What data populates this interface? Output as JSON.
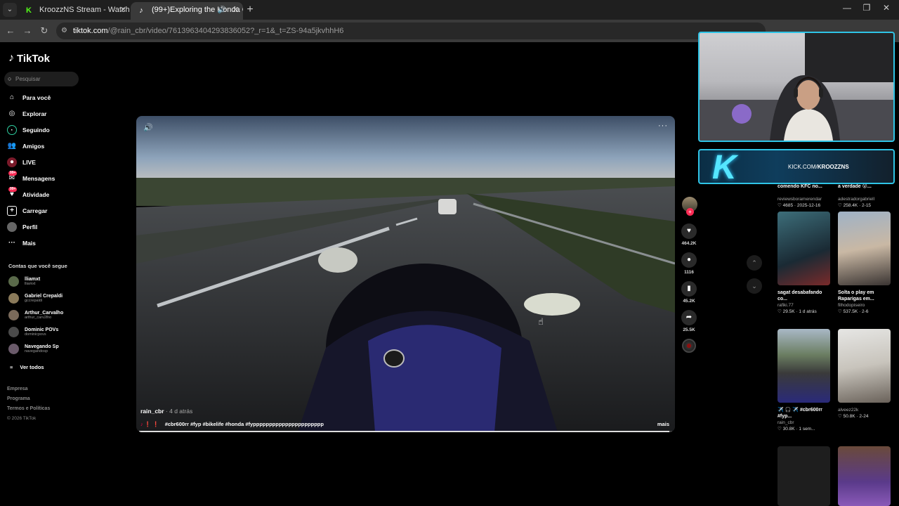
{
  "browser": {
    "tabs": [
      {
        "title": "KroozzNS Stream - Watch Live",
        "favicon": "K",
        "active": false
      },
      {
        "title": "(99+)Exploring the Honda C",
        "favicon": "♪",
        "active": true
      }
    ],
    "url_host": "tiktok.com",
    "url_path": "/@rain_cbr/video/7613963404293836052?_r=1&_t=ZS-94a5jkvhhH6"
  },
  "sidebar": {
    "brand": "TikTok",
    "search_placeholder": "Pesquisar",
    "nav": [
      {
        "label": "Para você",
        "icon": "home-icon"
      },
      {
        "label": "Explorar",
        "icon": "compass-icon"
      },
      {
        "label": "Seguindo",
        "icon": "following-icon"
      },
      {
        "label": "Amigos",
        "icon": "friends-icon"
      },
      {
        "label": "LIVE",
        "icon": "live-icon"
      },
      {
        "label": "Mensagens",
        "icon": "messages-icon",
        "badge": "99+"
      },
      {
        "label": "Atividade",
        "icon": "activity-icon",
        "badge": "99+"
      },
      {
        "label": "Carregar",
        "icon": "upload-icon"
      },
      {
        "label": "Perfil",
        "icon": "profile-icon"
      },
      {
        "label": "Mais",
        "icon": "more-icon"
      }
    ],
    "following_title": "Contas que você segue",
    "following": [
      {
        "name": "lliamxt",
        "handle": "lliamxt"
      },
      {
        "name": "Gabriel Crepaldi",
        "handle": "gccrepaldi"
      },
      {
        "name": "Arthur_Carvalho",
        "handle": "arthur_carv2lho"
      },
      {
        "name": "Dominic POVs",
        "handle": "dominicpovs"
      },
      {
        "name": "Navegando Sp",
        "handle": "navegandosp"
      }
    ],
    "see_all": "Ver todos",
    "footer": [
      "Empresa",
      "Programa",
      "Termos e Políticas"
    ],
    "copyright": "© 2026 TikTok"
  },
  "video": {
    "author": "rain_cbr",
    "posted": "· 4 d atrás",
    "caption_emojis": "♪ ❗ ❗",
    "caption": "#cbr600rr #fyp #bikelife #honda #fypppppppppppppppppppppp",
    "more_label": "mais",
    "progress": 0.995
  },
  "actions": {
    "likes": "464.2K",
    "comments": "1116",
    "saves": "45.2K",
    "shares": "25.5K"
  },
  "related": [
    {
      "title": "comendo KFC no...",
      "author": "reviewsboramerendar",
      "likes": "4685",
      "date": "· 2025-12-16"
    },
    {
      "title": "a verdade 😮...",
      "author": "adestradorgabriell",
      "likes": "258.4K",
      "date": "· 2-15"
    },
    {
      "title": "sagat desabafando co...",
      "author": "rafiki.77",
      "likes": "29.5K",
      "date": "· 1 d atrás"
    },
    {
      "title": "Solta o play em Raparigas em...",
      "author": "filhodopiseiro",
      "likes": "537.5K",
      "date": "· 2-6"
    },
    {
      "title": "✈️ 🎧 ✈️ #cbr600rr #fyp...",
      "author": "rain_cbr",
      "likes": "30.8K",
      "date": "· 1 sem..."
    },
    {
      "title": "",
      "author": "alveez22k",
      "likes": "50.8K",
      "date": "· 2-24"
    }
  ],
  "overlay": {
    "kick_prefix": "KICK.COM/",
    "kick_user": "KROOZZNS",
    "logo_letter": "K"
  },
  "colors": {
    "accent": "#fe2c55",
    "overlay_border": "#2fc4e6"
  }
}
